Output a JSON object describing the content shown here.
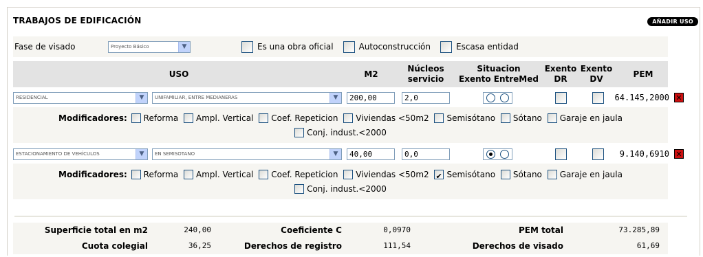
{
  "title": "TRABAJOS DE EDIFICACIÓN",
  "add_button": "AÑADIR USO",
  "fase": {
    "label": "Fase de visado",
    "select_value": "Proyecto Básico",
    "checks": [
      {
        "label": "Es una obra oficial",
        "checked": false
      },
      {
        "label": "Autoconstrucción",
        "checked": false
      },
      {
        "label": "Escasa entidad",
        "checked": false
      }
    ]
  },
  "table_header": {
    "uso": "USO",
    "m2": "M2",
    "nucleos_1": "Núcleos",
    "nucleos_2": "servicio",
    "situacion_1": "Situacion",
    "situacion_2": "Exento EntreMed",
    "exento_dr_1": "Exento",
    "exento_dr_2": "DR",
    "exento_dv_1": "Exento",
    "exento_dv_2": "DV",
    "pem": "PEM"
  },
  "rows": [
    {
      "uso": "RESIDENCIAL",
      "subuso": "UNIFAMILIAR, ENTRE MEDIANERAS",
      "m2": "200,00",
      "nucleos": "2,0",
      "situacion": "none",
      "exento_dr": false,
      "exento_dv": false,
      "pem": "64.145,2000"
    },
    {
      "uso": "ESTACIONAMIENTO DE VEHÍCULOS",
      "subuso": "EN SEMISOTANO",
      "m2": "40,00",
      "nucleos": "0,0",
      "situacion": "exento",
      "exento_dr": false,
      "exento_dv": false,
      "pem": "9.140,6910"
    }
  ],
  "modifiers": {
    "title": "Modificadores:",
    "labels": {
      "reforma": "Reforma",
      "ampl": "Ampl. Vertical",
      "coef": "Coef. Repeticion",
      "viviendas": "Viviendas <50m2",
      "semisotano": "Semisótano",
      "sotano": "Sótano",
      "garaje": "Garaje en jaula",
      "conj": "Conj. indust.<2000"
    },
    "row1_checked": [],
    "row2_checked": [
      "semisotano"
    ]
  },
  "totals": {
    "superficie_label": "Superficie total en m2",
    "superficie_value": "240,00",
    "coef_label": "Coeficiente C",
    "coef_value": "0,0970",
    "pem_total_label": "PEM total",
    "pem_total_value": "73.285,89",
    "cuota_label": "Cuota colegial",
    "cuota_value": "36,25",
    "derechos_reg_label": "Derechos de registro",
    "derechos_reg_value": "111,54",
    "derechos_vis_label": "Derechos de visado",
    "derechos_vis_value": "61,69"
  },
  "icons": {
    "dropdown": "chevron-down-icon",
    "delete": "delete-x-icon"
  }
}
